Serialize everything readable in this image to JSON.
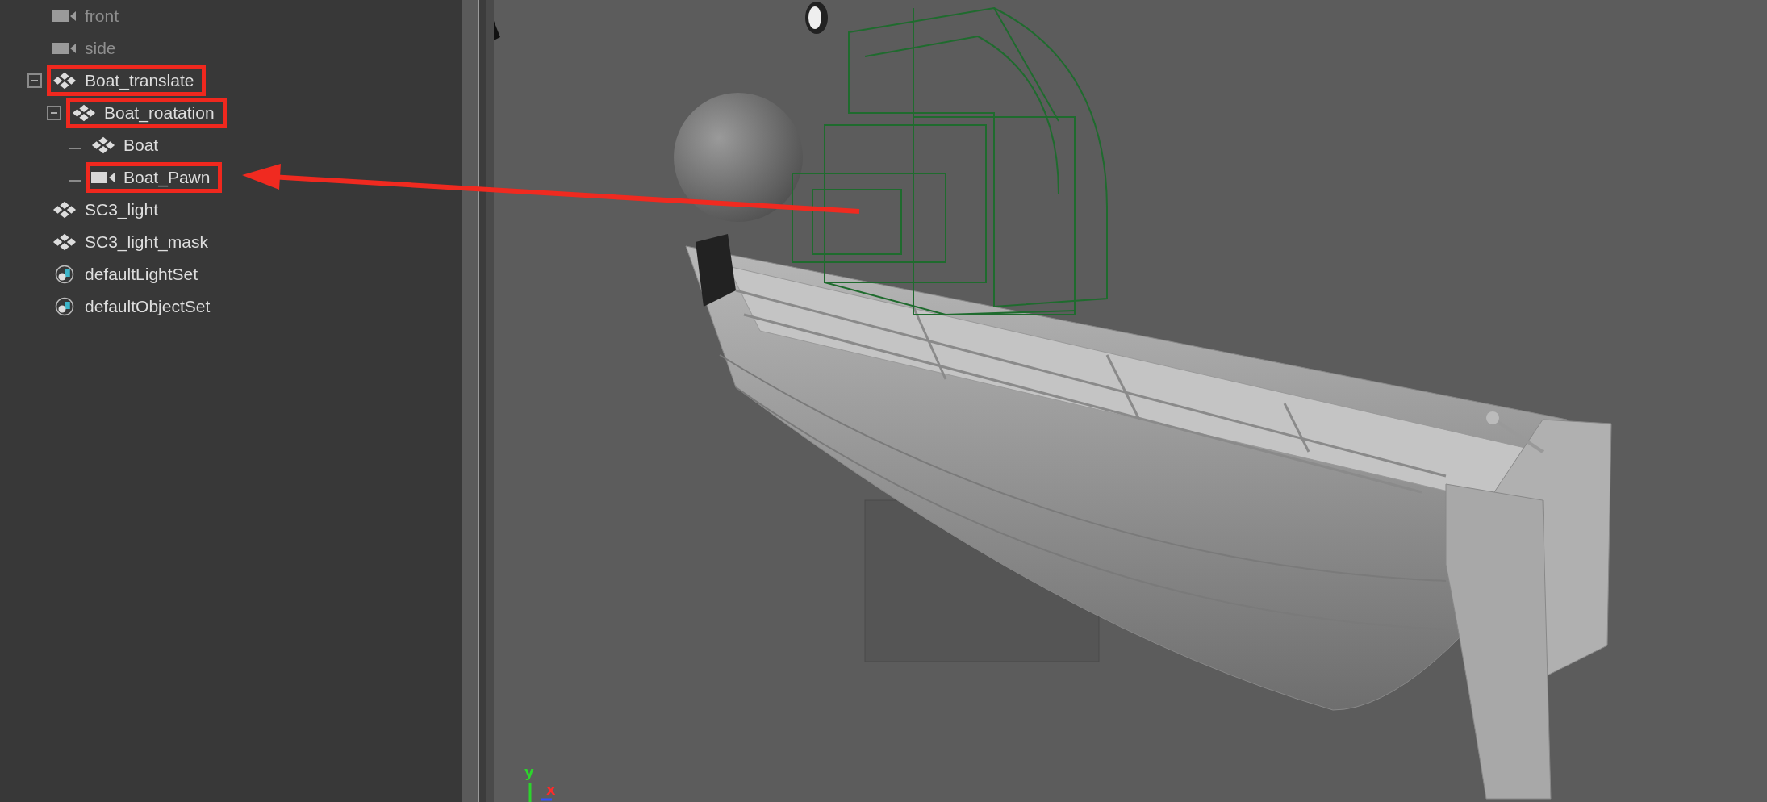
{
  "outliner": {
    "items": [
      {
        "label": "front",
        "kind": "camera",
        "hidden": true,
        "highlighted": false
      },
      {
        "label": "side",
        "kind": "camera",
        "hidden": true,
        "highlighted": false
      },
      {
        "label": "Boat_translate",
        "kind": "transform",
        "hidden": false,
        "highlighted": true,
        "expanded": true,
        "children": [
          {
            "label": "Boat_roatation",
            "kind": "transform",
            "hidden": false,
            "highlighted": true,
            "expanded": true,
            "children": [
              {
                "label": "Boat",
                "kind": "transform",
                "hidden": false,
                "highlighted": false
              },
              {
                "label": "Boat_Pawn",
                "kind": "camera",
                "hidden": false,
                "highlighted": true
              }
            ]
          }
        ]
      },
      {
        "label": "SC3_light",
        "kind": "transform",
        "hidden": false,
        "highlighted": false
      },
      {
        "label": "SC3_light_mask",
        "kind": "transform",
        "hidden": false,
        "highlighted": false
      },
      {
        "label": "defaultLightSet",
        "kind": "set",
        "hidden": false,
        "highlighted": false
      },
      {
        "label": "defaultObjectSet",
        "kind": "set",
        "hidden": false,
        "highlighted": false
      }
    ]
  },
  "viewport": {
    "axis_labels": [
      "y",
      "x"
    ]
  }
}
